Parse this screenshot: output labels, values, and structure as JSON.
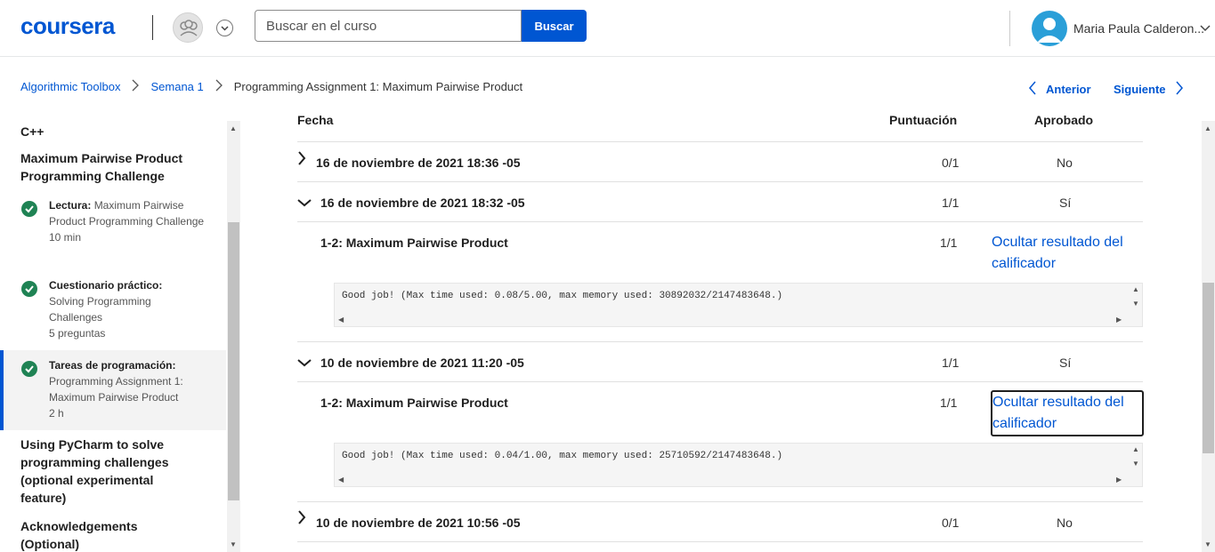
{
  "header": {
    "logo": "coursera",
    "search_placeholder": "Buscar en el curso",
    "search_button": "Buscar",
    "user_name": "Maria Paula Calderon..."
  },
  "breadcrumb": {
    "items": [
      "Algorithmic Toolbox",
      "Semana 1",
      "Programming Assignment 1: Maximum Pairwise Product"
    ],
    "prev": "Anterior",
    "next": "Siguiente"
  },
  "sidebar": {
    "lang": "C++",
    "section_title": "Maximum Pairwise Product Programming Challenge",
    "lessons": [
      {
        "type": "Lectura:",
        "title": "Maximum Pairwise Product Programming Challenge",
        "duration": "10 min"
      },
      {
        "type": "Cuestionario práctico:",
        "title": "Solving Programming Challenges",
        "duration": "5 preguntas"
      },
      {
        "type": "Tareas de programación:",
        "title": "Programming Assignment 1: Maximum Pairwise Product",
        "duration": "2 h"
      }
    ],
    "next_sections": [
      "Using PyCharm to solve programming challenges (optional experimental feature)",
      "Acknowledgements (Optional)"
    ]
  },
  "table": {
    "col_date": "Fecha",
    "col_score": "Puntuación",
    "col_pass": "Aprobado",
    "rows": [
      {
        "date": "16 de noviembre de 2021 18:36 -05",
        "score": "0/1",
        "pass": "No"
      },
      {
        "date": "16 de noviembre de 2021 18:32 -05",
        "score": "1/1",
        "pass": "Sí",
        "part": "1-2: Maximum Pairwise Product",
        "part_score": "1/1",
        "toggle": "Ocultar resultado del calificador",
        "output": "Good job! (Max time used: 0.08/5.00, max memory used: 30892032/2147483648.)"
      },
      {
        "date": "10 de noviembre de 2021 11:20 -05",
        "score": "1/1",
        "pass": "Sí",
        "part": "1-2: Maximum Pairwise Product",
        "part_score": "1/1",
        "toggle": "Ocultar resultado del calificador",
        "output": "Good job! (Max time used: 0.04/1.00, max memory used: 25710592/2147483648.)"
      },
      {
        "date": "10 de noviembre de 2021 10:56 -05",
        "score": "0/1",
        "pass": "No"
      }
    ]
  },
  "colors": {
    "accent": "#0056d2",
    "success": "#1f8354"
  }
}
